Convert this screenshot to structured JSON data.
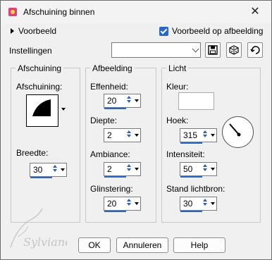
{
  "window": {
    "title": "Afschuining binnen",
    "close_label": "✕"
  },
  "preview": {
    "toggle_label": "Voorbeeld",
    "checkbox_label": "Voorbeeld op afbeelding",
    "checkbox_checked": true
  },
  "settings": {
    "label": "Instellingen",
    "value": ""
  },
  "groups": {
    "bevel": {
      "title": "Afschuining",
      "shape_label": "Afschuining:",
      "width_label": "Breedte:",
      "width_value": "30"
    },
    "image": {
      "title": "Afbeelding",
      "smoothness_label": "Effenheid:",
      "smoothness_value": "20",
      "depth_label": "Diepte:",
      "depth_value": "2",
      "ambience_label": "Ambiance:",
      "ambience_value": "2",
      "shininess_label": "Glinstering:",
      "shininess_value": "20"
    },
    "light": {
      "title": "Licht",
      "color_label": "Kleur:",
      "color_value": "#ffffff",
      "angle_label": "Hoek:",
      "angle_value": "315",
      "intensity_label": "Intensiteit:",
      "intensity_value": "50",
      "elevation_label": "Stand lichtbron:",
      "elevation_value": "30"
    }
  },
  "buttons": {
    "ok": "OK",
    "cancel": "Annuleren",
    "help": "Help"
  },
  "watermark": "Sylviane"
}
